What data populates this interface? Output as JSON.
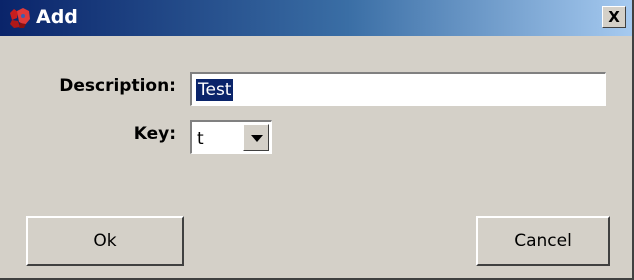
{
  "window": {
    "title": "Add",
    "icon": "app-icon",
    "close_label": "X"
  },
  "form": {
    "description_label": "Description:",
    "description_value": "Test",
    "key_label": "Key:",
    "key_value": "t"
  },
  "buttons": {
    "ok_label": "Ok",
    "cancel_label": "Cancel"
  },
  "colors": {
    "titlebar_start": "#0a246a",
    "titlebar_end": "#a6caf0",
    "dialog_bg": "#d4d0c8",
    "selection_bg": "#0a246a"
  }
}
